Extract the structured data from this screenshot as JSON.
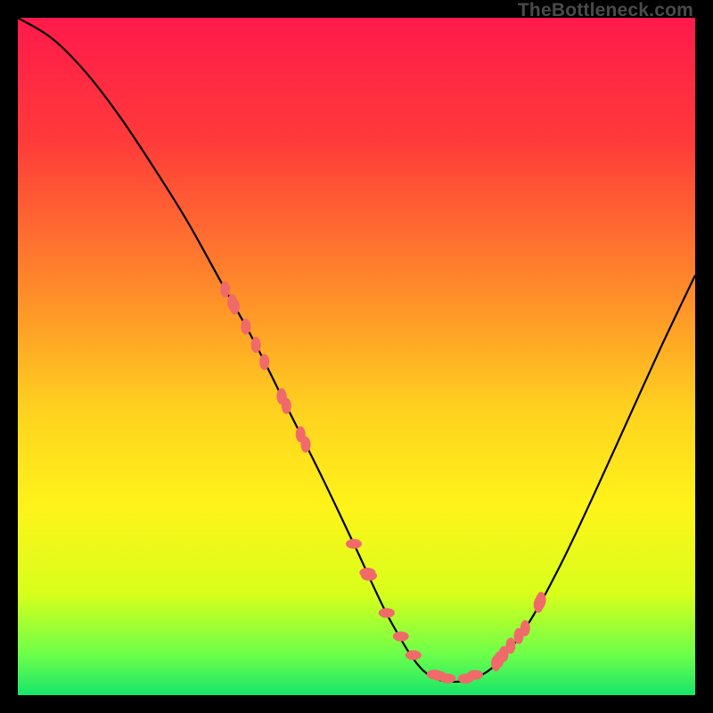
{
  "watermark": "TheBottleneck.com",
  "chart_data": {
    "type": "line",
    "title": "",
    "xlabel": "",
    "ylabel": "",
    "xlim": [
      0,
      100
    ],
    "ylim": [
      0,
      100
    ],
    "gradient_stops": [
      {
        "offset": 0,
        "color": "#ff1a4b"
      },
      {
        "offset": 18,
        "color": "#ff3a3a"
      },
      {
        "offset": 40,
        "color": "#ff8a2a"
      },
      {
        "offset": 58,
        "color": "#ffd21f"
      },
      {
        "offset": 72,
        "color": "#fff31a"
      },
      {
        "offset": 85,
        "color": "#d8ff1a"
      },
      {
        "offset": 94,
        "color": "#6dff4a"
      },
      {
        "offset": 100,
        "color": "#17e66a"
      }
    ],
    "curve": {
      "description": "V-shaped bottleneck curve; high mismatch at edges, minimum near x≈60",
      "x": [
        0,
        5,
        10,
        15,
        20,
        25,
        30,
        35,
        40,
        45,
        50,
        55,
        60,
        65,
        70,
        75,
        80,
        85,
        90,
        95,
        100
      ],
      "y": [
        100,
        97,
        92,
        85.5,
        78,
        70,
        61,
        52,
        42,
        32,
        21.5,
        11,
        3.5,
        2,
        4,
        10,
        19,
        29.5,
        40.5,
        51.5,
        62
      ]
    },
    "highlight_dots": {
      "color": "#f06a6a",
      "left_cluster": {
        "x_range": [
          30,
          43
        ],
        "y_range": [
          11,
          27
        ],
        "count": 11
      },
      "bottom_cluster": {
        "x_range": [
          49,
          68
        ],
        "y_range": [
          2,
          5
        ],
        "count": 11
      },
      "right_cluster": {
        "x_range": [
          70,
          78
        ],
        "y_range": [
          6,
          20
        ],
        "count": 9
      }
    }
  }
}
